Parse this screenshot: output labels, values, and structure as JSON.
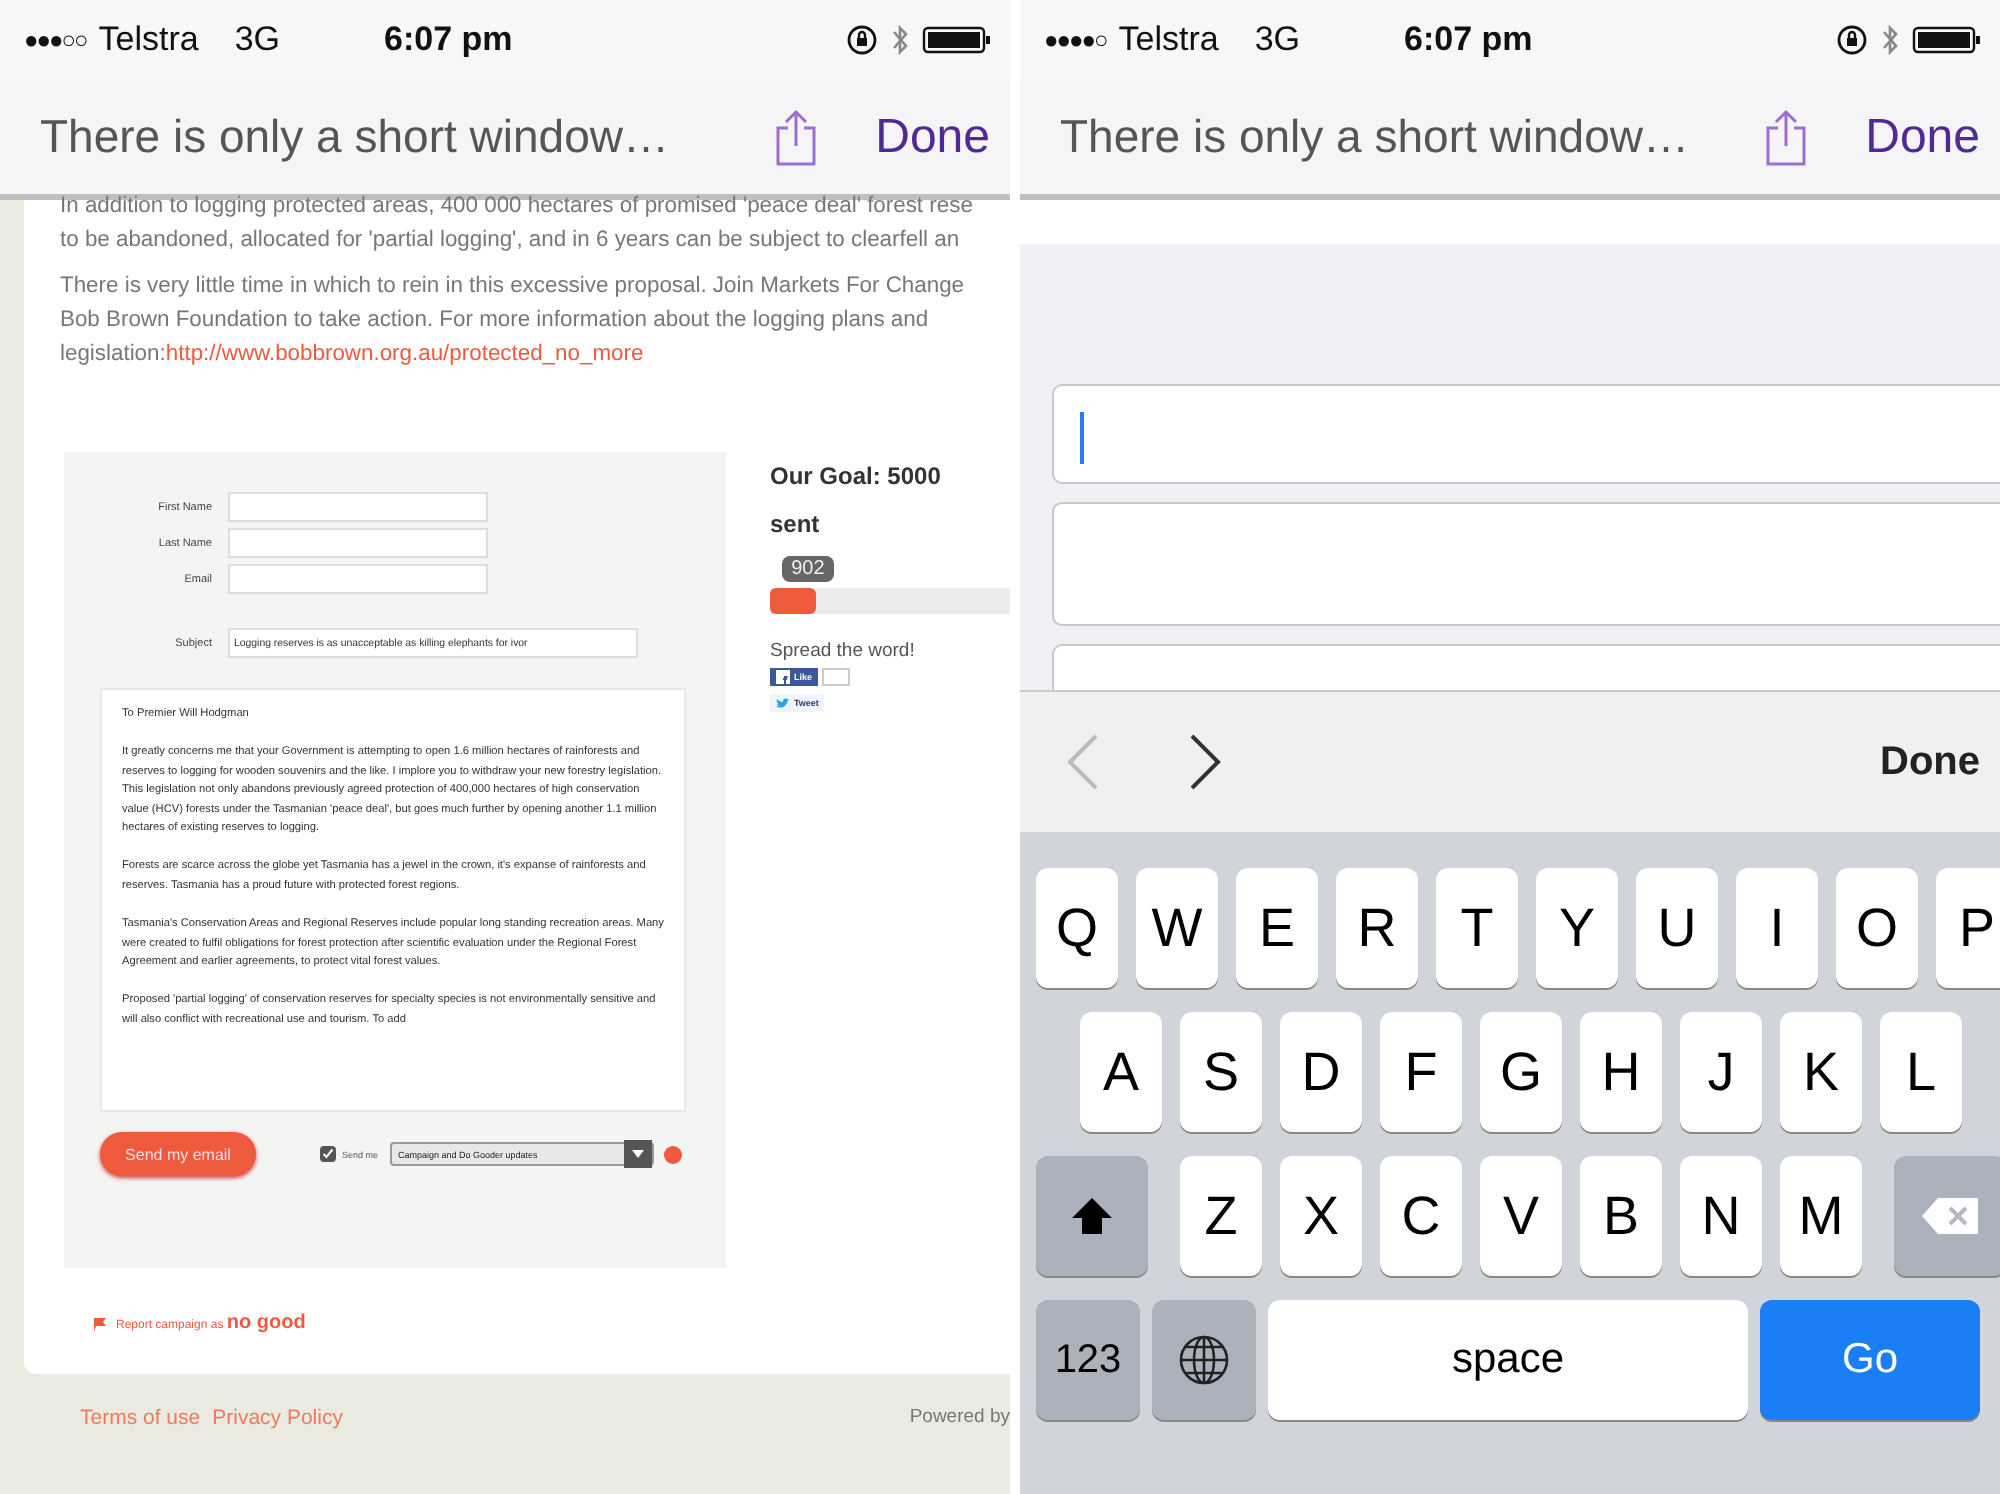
{
  "phones": [
    {
      "kind": "page",
      "status": {
        "signal": "●●●○○",
        "carrier": "Telstra",
        "network": "3G",
        "time": "6:07 pm"
      },
      "nav": {
        "title": "There is only a short window…",
        "button": "Done"
      },
      "page": {
        "intro_lines": [
          "In addition to logging protected areas, 400 000 hectares of promised 'peace deal' forest rese",
          "to be abandoned, allocated for 'partial logging', and in 6 years can be subject to clearfell an"
        ],
        "paragraph": {
          "text": "There is very little time in which to rein in this excessive proposal. Join Markets For Change Bob Brown Foundation to take action. For more information about the logging plans and legislation:",
          "link": "http://www.bobbrown.org.au/protected_no_more"
        },
        "fields": [
          {
            "label": "First Name"
          },
          {
            "label": "Last Name"
          },
          {
            "label": "Email"
          }
        ],
        "subject": {
          "label": "Subject",
          "value": "Logging reserves is as unacceptable as killing elephants for ivor"
        },
        "letter": [
          "To Premier Will Hodgman",
          "It greatly concerns me that your Government is attempting to open 1.6 million hectares of rainforests and reserves to logging for wooden souvenirs and the like.  I implore you to withdraw your new forestry legislation. This legislation not only abandons previously agreed protection of 400,000 hectares of high conservation value (HCV) forests under the Tasmanian 'peace deal', but goes much further by opening another 1.1 million hectares of existing reserves to logging.",
          "Forests are scarce across the globe yet Tasmania has a jewel in the crown, it's expanse of rainforests and reserves.  Tasmania has a proud future with protected forest regions.",
          "Tasmania's Conservation Areas and Regional Reserves include popular long standing recreation areas. Many were created to fulfil obligations for forest protection after scientific evaluation under the Regional Forest Agreement and earlier agreements, to protect vital forest values.",
          "Proposed 'partial logging' of conservation reserves for specialty species is not environmentally sensitive and will also conflict with recreational use and tourism.  To add"
        ],
        "send_button": "Send my email",
        "opt_in": {
          "label": "Send me",
          "checked": true
        },
        "updates_select": "Campaign and Do Gooder updates",
        "goal": {
          "title": "Our Goal: 5000",
          "subtitle": "sent",
          "count": "902",
          "level": 0.18
        },
        "share": {
          "title": "Spread the word!",
          "like": "Like",
          "tweet": "Tweet"
        },
        "report": {
          "text": "Report campaign as",
          "emphasis": "no good"
        },
        "footer": {
          "links": [
            "Terms of use",
            "Privacy Policy"
          ],
          "powered": "Powered by"
        }
      }
    },
    {
      "kind": "form",
      "status": {
        "signal": "●●●●○",
        "carrier": "Telstra",
        "network": "3G",
        "time": "6:07 pm"
      },
      "nav": {
        "title": "There is only a short window…",
        "button": "Done"
      },
      "form": {
        "fields": [
          {
            "focused": true
          },
          {
            "focused": false
          },
          {
            "focused": false
          }
        ],
        "accessory": {
          "prev_disabled": true,
          "next_disabled": false,
          "done": "Done"
        },
        "rows": [
          [
            "Q",
            "W",
            "E",
            "R",
            "T",
            "Y",
            "U",
            "I",
            "O",
            "P"
          ],
          [
            "A",
            "S",
            "D",
            "F",
            "G",
            "H",
            "J",
            "K",
            "L"
          ],
          [
            "Z",
            "X",
            "C",
            "V",
            "B",
            "N",
            "M"
          ]
        ],
        "bottom": {
          "numbers": "123",
          "space": "space",
          "go": "Go"
        }
      }
    }
  ]
}
